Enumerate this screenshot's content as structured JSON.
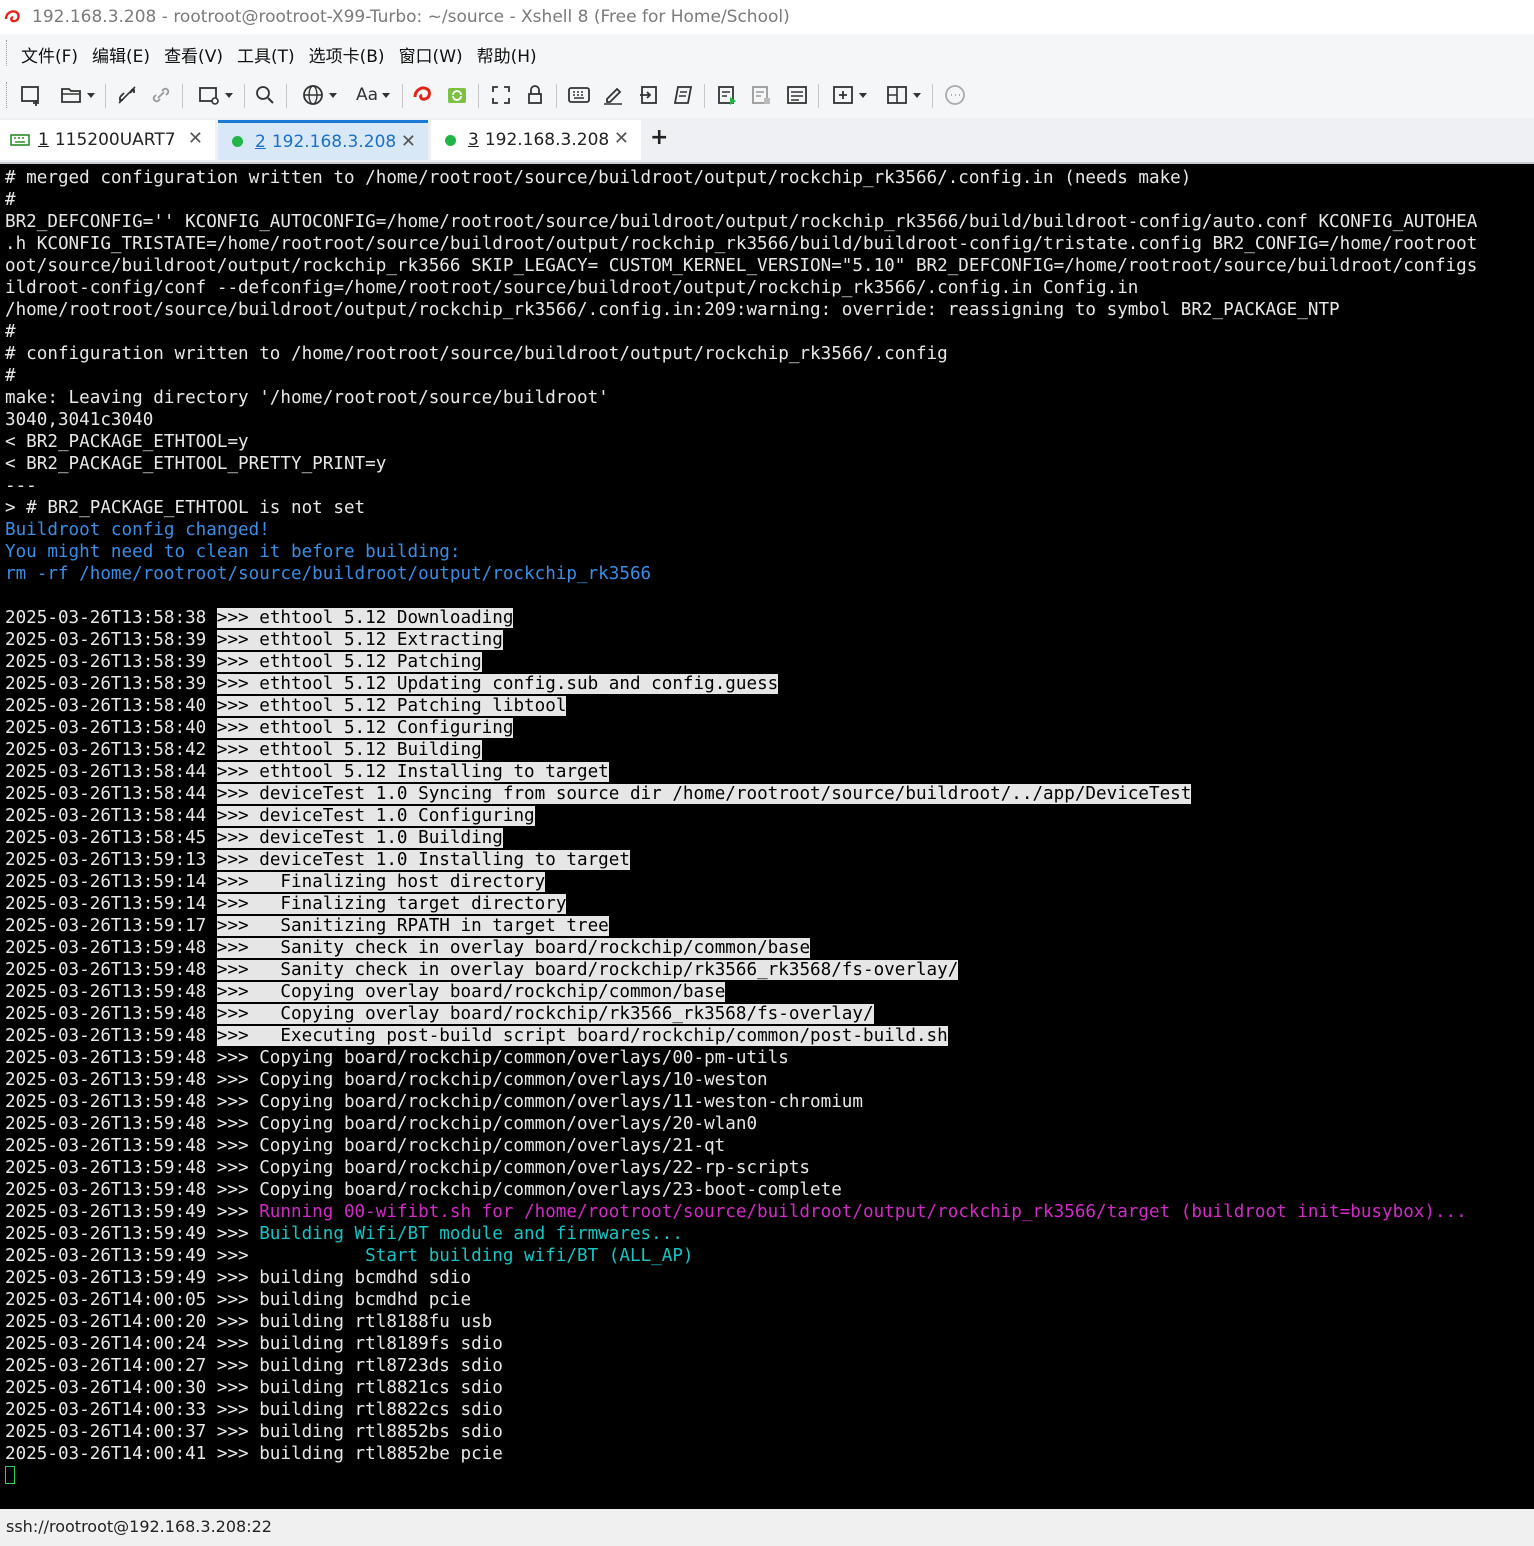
{
  "window": {
    "title": "192.168.3.208 - rootroot@rootroot-X99-Turbo: ~/source - Xshell 8 (Free for Home/School)"
  },
  "menu": [
    "文件(F)",
    "编辑(E)",
    "查看(V)",
    "工具(T)",
    "选项卡(B)",
    "窗口(W)",
    "帮助(H)"
  ],
  "toolbar": {
    "font_label": "Aa"
  },
  "tabs": [
    {
      "num": "1",
      "label": "115200UART7",
      "icon": "serial-icon",
      "active": false
    },
    {
      "num": "2",
      "label": "192.168.3.208",
      "icon": "connected-dot-icon",
      "active": true
    },
    {
      "num": "3",
      "label": "192.168.3.208",
      "icon": "connected-dot-icon",
      "active": false
    }
  ],
  "add_tab": "+",
  "terminal": {
    "lines": [
      [
        {
          "t": "# merged configuration written to /home/rootroot/source/buildroot/output/rockchip_rk3566/.config.in (needs make)"
        }
      ],
      [
        {
          "t": "#"
        }
      ],
      [
        {
          "t": "BR2_DEFCONFIG='' KCONFIG_AUTOCONFIG=/home/rootroot/source/buildroot/output/rockchip_rk3566/build/buildroot-config/auto.conf KCONFIG_AUTOHEA"
        }
      ],
      [
        {
          "t": ".h KCONFIG_TRISTATE=/home/rootroot/source/buildroot/output/rockchip_rk3566/build/buildroot-config/tristate.config BR2_CONFIG=/home/rootroot"
        }
      ],
      [
        {
          "t": "oot/source/buildroot/output/rockchip_rk3566 SKIP_LEGACY= CUSTOM_KERNEL_VERSION=\"5.10\" BR2_DEFCONFIG=/home/rootroot/source/buildroot/configs"
        }
      ],
      [
        {
          "t": "ildroot-config/conf --defconfig=/home/rootroot/source/buildroot/output/rockchip_rk3566/.config.in Config.in"
        }
      ],
      [
        {
          "t": "/home/rootroot/source/buildroot/output/rockchip_rk3566/.config.in:209:warning: override: reassigning to symbol BR2_PACKAGE_NTP"
        }
      ],
      [
        {
          "t": "#"
        }
      ],
      [
        {
          "t": "# configuration written to /home/rootroot/source/buildroot/output/rockchip_rk3566/.config"
        }
      ],
      [
        {
          "t": "#"
        }
      ],
      [
        {
          "t": "make: Leaving directory '/home/rootroot/source/buildroot'"
        }
      ],
      [
        {
          "t": "3040,3041c3040"
        }
      ],
      [
        {
          "t": "< BR2_PACKAGE_ETHTOOL=y"
        }
      ],
      [
        {
          "t": "< BR2_PACKAGE_ETHTOOL_PRETTY_PRINT=y"
        }
      ],
      [
        {
          "t": "---"
        }
      ],
      [
        {
          "t": "> # BR2_PACKAGE_ETHTOOL is not set"
        }
      ],
      [
        {
          "t": "Buildroot config changed!",
          "c": "blue"
        }
      ],
      [
        {
          "t": "You might need to clean it before building:",
          "c": "blue"
        }
      ],
      [
        {
          "t": "rm -rf /home/rootroot/source/buildroot/output/rockchip_rk3566",
          "c": "blue"
        }
      ],
      [
        {
          "t": ""
        }
      ],
      [
        {
          "t": "2025-03-26T13:58:38 "
        },
        {
          "t": ">>> ethtool 5.12 Downloading",
          "c": "hl"
        }
      ],
      [
        {
          "t": "2025-03-26T13:58:39 "
        },
        {
          "t": ">>> ethtool 5.12 Extracting",
          "c": "hl"
        }
      ],
      [
        {
          "t": "2025-03-26T13:58:39 "
        },
        {
          "t": ">>> ethtool 5.12 Patching",
          "c": "hl"
        }
      ],
      [
        {
          "t": "2025-03-26T13:58:39 "
        },
        {
          "t": ">>> ethtool 5.12 Updating config.sub and config.guess",
          "c": "hl"
        }
      ],
      [
        {
          "t": "2025-03-26T13:58:40 "
        },
        {
          "t": ">>> ethtool 5.12 Patching libtool",
          "c": "hl"
        }
      ],
      [
        {
          "t": "2025-03-26T13:58:40 "
        },
        {
          "t": ">>> ethtool 5.12 Configuring",
          "c": "hl"
        }
      ],
      [
        {
          "t": "2025-03-26T13:58:42 "
        },
        {
          "t": ">>> ethtool 5.12 Building",
          "c": "hl"
        }
      ],
      [
        {
          "t": "2025-03-26T13:58:44 "
        },
        {
          "t": ">>> ethtool 5.12 Installing to target",
          "c": "hl"
        }
      ],
      [
        {
          "t": "2025-03-26T13:58:44 "
        },
        {
          "t": ">>> deviceTest 1.0 Syncing from source dir /home/rootroot/source/buildroot/../app/DeviceTest",
          "c": "hl"
        }
      ],
      [
        {
          "t": "2025-03-26T13:58:44 "
        },
        {
          "t": ">>> deviceTest 1.0 Configuring",
          "c": "hl"
        }
      ],
      [
        {
          "t": "2025-03-26T13:58:45 "
        },
        {
          "t": ">>> deviceTest 1.0 Building",
          "c": "hl"
        }
      ],
      [
        {
          "t": "2025-03-26T13:59:13 "
        },
        {
          "t": ">>> deviceTest 1.0 Installing to target",
          "c": "hl"
        }
      ],
      [
        {
          "t": "2025-03-26T13:59:14 "
        },
        {
          "t": ">>>   Finalizing host directory",
          "c": "hl"
        }
      ],
      [
        {
          "t": "2025-03-26T13:59:14 "
        },
        {
          "t": ">>>   Finalizing target directory",
          "c": "hl"
        }
      ],
      [
        {
          "t": "2025-03-26T13:59:17 "
        },
        {
          "t": ">>>   Sanitizing RPATH in target tree",
          "c": "hl"
        }
      ],
      [
        {
          "t": "2025-03-26T13:59:48 "
        },
        {
          "t": ">>>   Sanity check in overlay board/rockchip/common/base",
          "c": "hl"
        }
      ],
      [
        {
          "t": "2025-03-26T13:59:48 "
        },
        {
          "t": ">>>   Sanity check in overlay board/rockchip/rk3566_rk3568/fs-overlay/",
          "c": "hl"
        }
      ],
      [
        {
          "t": "2025-03-26T13:59:48 "
        },
        {
          "t": ">>>   Copying overlay board/rockchip/common/base",
          "c": "hl"
        }
      ],
      [
        {
          "t": "2025-03-26T13:59:48 "
        },
        {
          "t": ">>>   Copying overlay board/rockchip/rk3566_rk3568/fs-overlay/",
          "c": "hl"
        }
      ],
      [
        {
          "t": "2025-03-26T13:59:48 "
        },
        {
          "t": ">>>   Executing post-build script board/rockchip/common/post-build.sh",
          "c": "hl"
        }
      ],
      [
        {
          "t": "2025-03-26T13:59:48 >>> Copying board/rockchip/common/overlays/00-pm-utils"
        }
      ],
      [
        {
          "t": "2025-03-26T13:59:48 >>> Copying board/rockchip/common/overlays/10-weston"
        }
      ],
      [
        {
          "t": "2025-03-26T13:59:48 >>> Copying board/rockchip/common/overlays/11-weston-chromium"
        }
      ],
      [
        {
          "t": "2025-03-26T13:59:48 >>> Copying board/rockchip/common/overlays/20-wlan0"
        }
      ],
      [
        {
          "t": "2025-03-26T13:59:48 >>> Copying board/rockchip/common/overlays/21-qt"
        }
      ],
      [
        {
          "t": "2025-03-26T13:59:48 >>> Copying board/rockchip/common/overlays/22-rp-scripts"
        }
      ],
      [
        {
          "t": "2025-03-26T13:59:48 >>> Copying board/rockchip/common/overlays/23-boot-complete"
        }
      ],
      [
        {
          "t": "2025-03-26T13:59:49 >>> "
        },
        {
          "t": "Running 00-wifibt.sh for /home/rootroot/source/buildroot/output/rockchip_rk3566/target (buildroot init=busybox)...",
          "c": "mag"
        }
      ],
      [
        {
          "t": "2025-03-26T13:59:49 >>> "
        },
        {
          "t": "Building Wifi/BT module and firmwares...",
          "c": "cyan"
        }
      ],
      [
        {
          "t": "2025-03-26T13:59:49 >>>           "
        },
        {
          "t": "Start building wifi/BT (ALL_AP)",
          "c": "cyan"
        }
      ],
      [
        {
          "t": "2025-03-26T13:59:49 >>> building bcmdhd sdio"
        }
      ],
      [
        {
          "t": "2025-03-26T14:00:05 >>> building bcmdhd pcie"
        }
      ],
      [
        {
          "t": "2025-03-26T14:00:20 >>> building rtl8188fu usb"
        }
      ],
      [
        {
          "t": "2025-03-26T14:00:24 >>> building rtl8189fs sdio"
        }
      ],
      [
        {
          "t": "2025-03-26T14:00:27 >>> building rtl8723ds sdio"
        }
      ],
      [
        {
          "t": "2025-03-26T14:00:30 >>> building rtl8821cs sdio"
        }
      ],
      [
        {
          "t": "2025-03-26T14:00:33 >>> building rtl8822cs sdio"
        }
      ],
      [
        {
          "t": "2025-03-26T14:00:37 >>> building rtl8852bs sdio"
        }
      ],
      [
        {
          "t": "2025-03-26T14:00:41 >>> building rtl8852be pcie"
        }
      ]
    ]
  },
  "status": {
    "connection": "ssh://rootroot@192.168.3.208:22"
  },
  "colors": {
    "terminal_bg": "#000000",
    "terminal_fg": "#e8e8e8",
    "highlight_bg": "#e6e6e6",
    "info_blue": "#3a8ee6",
    "magenta": "#d22bc7",
    "cyan": "#19c3c3",
    "active_tab_accent": "#1b7ad6",
    "connected_green": "#22b54a"
  }
}
